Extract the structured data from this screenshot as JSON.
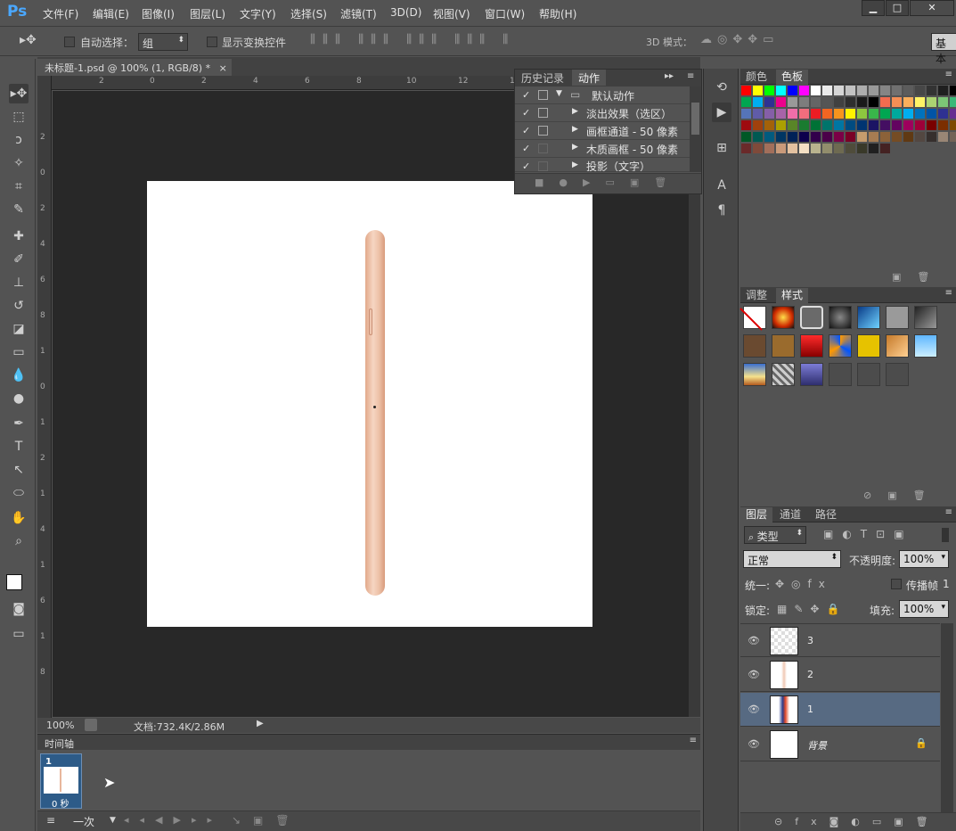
{
  "app": {
    "logo": "Ps"
  },
  "menus": [
    "文件(F)",
    "编辑(E)",
    "图像(I)",
    "图层(L)",
    "文字(Y)",
    "选择(S)",
    "滤镜(T)",
    "3D(D)",
    "视图(V)",
    "窗口(W)",
    "帮助(H)"
  ],
  "options": {
    "auto_select_label": "自动选择：",
    "auto_select_value": "组",
    "show_transform_label": "显示变换控件",
    "mode3d_label": "3D 模式：",
    "workspace_label": "基本"
  },
  "document": {
    "tab_title": "未标题-1.psd @ 100% (1, RGB/8) *",
    "zoom": "100%",
    "doc_info": "文档:732.4K/2.86M"
  },
  "ruler": {
    "h_ticks": [
      "2",
      "0",
      "2",
      "4",
      "6",
      "8",
      "10",
      "12",
      "14"
    ],
    "v_ticks": [
      "2",
      "0",
      "2",
      "4",
      "6",
      "8",
      "1",
      "0",
      "1",
      "2",
      "1",
      "4",
      "1",
      "6",
      "1",
      "8"
    ]
  },
  "actions_panel": {
    "tabs": [
      "历史记录",
      "动作"
    ],
    "active_tab": "动作",
    "rows": [
      {
        "label": "默认动作",
        "type": "folder"
      },
      {
        "label": "淡出效果（选区）",
        "type": "action"
      },
      {
        "label": "画框通道 - 50 像素",
        "type": "action"
      },
      {
        "label": "木质画框 - 50 像素",
        "type": "action"
      },
      {
        "label": "投影（文字）",
        "type": "action"
      }
    ]
  },
  "color_panel": {
    "tabs": [
      "颜色",
      "色板"
    ],
    "active_tab": "色板"
  },
  "adjust_panel": {
    "tabs": [
      "调整",
      "样式"
    ],
    "active_tab": "样式"
  },
  "layers_panel": {
    "tabs": [
      "图层",
      "通道",
      "路径"
    ],
    "active_tab": "图层",
    "filter_label": "类型",
    "blend_mode": "正常",
    "opacity_label": "不透明度:",
    "opacity_value": "100%",
    "unify_label": "统一:",
    "propagate_label": "传播帧",
    "propagate_num": "1",
    "lock_label": "锁定:",
    "fill_label": "填充:",
    "fill_value": "100%",
    "layers": [
      {
        "name": "3",
        "selected": false
      },
      {
        "name": "2",
        "selected": false
      },
      {
        "name": "1",
        "selected": true
      },
      {
        "name": "背景",
        "selected": false
      }
    ]
  },
  "timeline": {
    "title": "时间轴",
    "frame_number": "1",
    "frame_delay": "0 秒",
    "loop": "一次"
  },
  "colors": {
    "accent": "#4aa8ff",
    "panel_bg": "#535353",
    "canvas_bg": "#282828",
    "selected_layer": "#576a82"
  }
}
